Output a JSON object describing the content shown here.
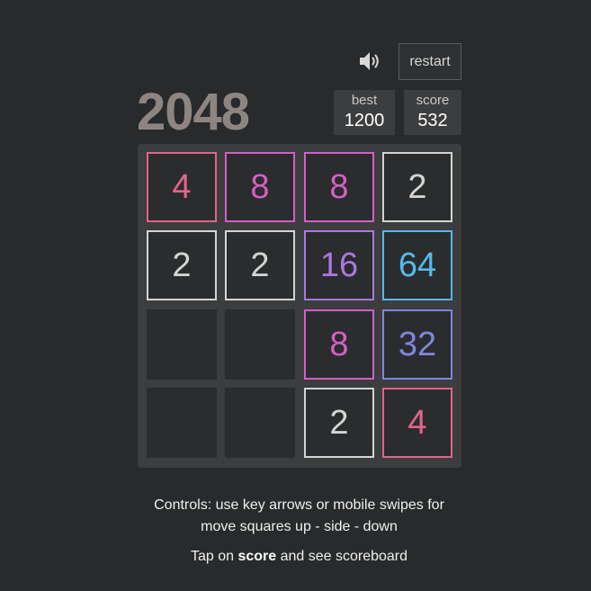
{
  "header": {
    "title": "2048",
    "restart_label": "restart",
    "sound_icon": "speaker-icon"
  },
  "scores": {
    "best_label": "best",
    "best_value": "1200",
    "score_label": "score",
    "score_value": "532"
  },
  "board": {
    "rows": [
      [
        {
          "value": "4",
          "color": "#e0648c"
        },
        {
          "value": "8",
          "color": "#d45ec6"
        },
        {
          "value": "8",
          "color": "#d45ec6"
        },
        {
          "value": "2",
          "color": "#d4d4d4"
        }
      ],
      [
        {
          "value": "2",
          "color": "#d4d4d4"
        },
        {
          "value": "2",
          "color": "#d4d4d4"
        },
        {
          "value": "16",
          "color": "#a878e0"
        },
        {
          "value": "64",
          "color": "#58b8ec"
        }
      ],
      [
        {
          "value": "",
          "color": ""
        },
        {
          "value": "",
          "color": ""
        },
        {
          "value": "8",
          "color": "#d45ec6"
        },
        {
          "value": "32",
          "color": "#7e86de"
        }
      ],
      [
        {
          "value": "",
          "color": ""
        },
        {
          "value": "",
          "color": ""
        },
        {
          "value": "2",
          "color": "#d4d4d4"
        },
        {
          "value": "4",
          "color": "#e0648c"
        }
      ]
    ]
  },
  "footer": {
    "controls_line1": "Controls: use key arrows or mobile swipes for",
    "controls_line2": "move squares up - side - down",
    "tap_prefix": "Tap on ",
    "tap_bold": "score",
    "tap_suffix": " and see scoreboard"
  }
}
